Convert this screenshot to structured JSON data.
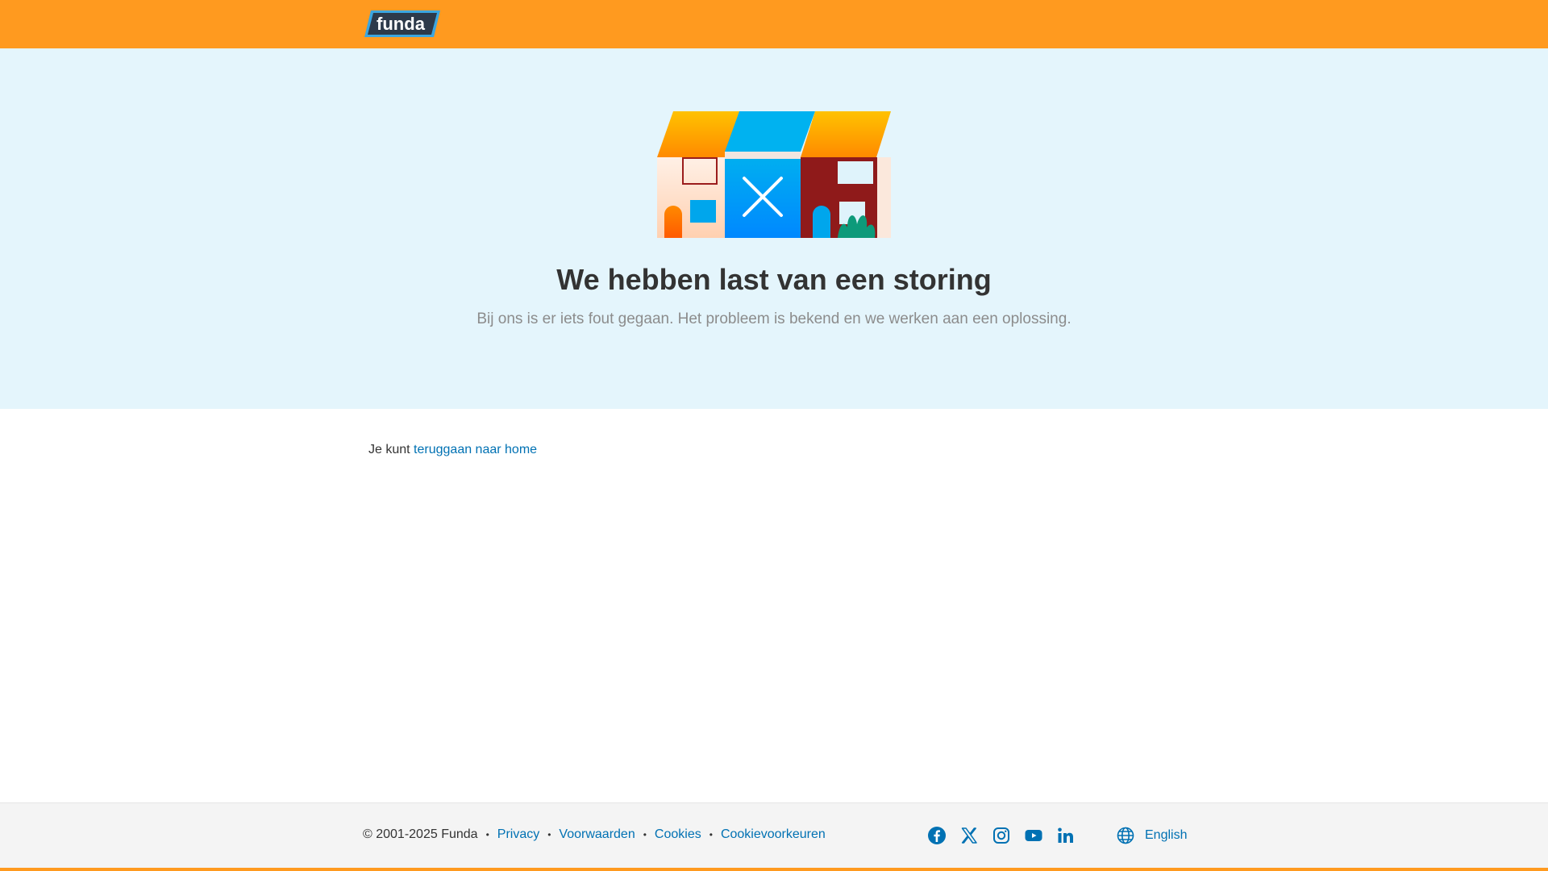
{
  "header": {
    "logo_text": "funda",
    "logo_icon": "funda-logo"
  },
  "hero": {
    "illustration": "broken-houses-illustration",
    "title": "We hebben last van een storing",
    "subtitle": "Bij ons is er iets fout gegaan. Het probleem is bekend en we werken aan een oplossing."
  },
  "main": {
    "back_prefix": "Je kunt",
    "back_link": "teruggaan naar home"
  },
  "footer": {
    "copyright": "© 2001-2025 Funda",
    "separator": "•",
    "links": [
      "Privacy",
      "Voorwaarden",
      "Cookies",
      "Cookievoorkeuren"
    ],
    "social_icons": [
      "facebook-icon",
      "x-icon",
      "instagram-icon",
      "youtube-icon",
      "linkedin-icon"
    ],
    "language_icon": "globe-icon",
    "language": "English"
  },
  "colors": {
    "brand_orange": "#ff9a1f",
    "hero_bg": "#e4f5fc",
    "link_blue": "#0071b3",
    "text_dark": "#333333",
    "text_muted": "#8c8c8c",
    "footer_bg": "#f4f4f4"
  }
}
